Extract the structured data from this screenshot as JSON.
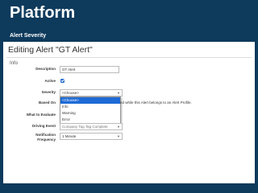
{
  "slide": {
    "title": "Platform",
    "subtitle": "Alert Severity"
  },
  "form": {
    "heading": "Editing Alert \"GT Alert\"",
    "section_label": "Info",
    "description": {
      "label": "Description",
      "value": "GT Alert"
    },
    "active": {
      "label": "Active",
      "checked": true
    },
    "severity": {
      "label": "Severity",
      "selected": "<Choose>",
      "options": [
        "<Choose>",
        "Info",
        "Warning",
        "Error"
      ]
    },
    "based_on": {
      "label": "Based On",
      "text": "ed while this Alert belongs to an Alert Profile."
    },
    "what_to_evaluate": {
      "label": "What to Evaluate"
    },
    "driving_event": {
      "label": "Driving Event",
      "value": "Company Tag Tag Complete"
    },
    "notification_frequency": {
      "label_line1": "Notification",
      "label_line2": "Frequency",
      "value": "1 Minute"
    }
  },
  "colors": {
    "background": "#0e3a5c",
    "panel": "#ffffff",
    "accent": "#1e6ad6"
  }
}
